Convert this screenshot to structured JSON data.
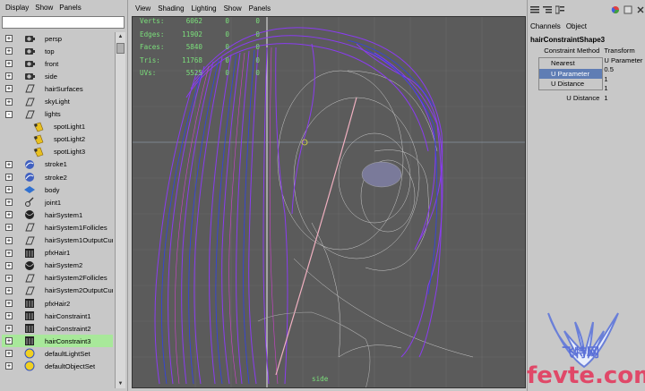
{
  "outliner": {
    "menu": [
      "Display",
      "Show",
      "Panels"
    ],
    "items": [
      {
        "label": "persp",
        "icon": "camera-icon",
        "exp": "+"
      },
      {
        "label": "top",
        "icon": "camera-icon",
        "exp": "+"
      },
      {
        "label": "front",
        "icon": "camera-icon",
        "exp": "+"
      },
      {
        "label": "side",
        "icon": "camera-icon",
        "exp": "+"
      },
      {
        "label": "hairSurfaces",
        "icon": "set-icon",
        "exp": "+"
      },
      {
        "label": "skyLight",
        "icon": "set-icon",
        "exp": "+"
      },
      {
        "label": "lights",
        "icon": "set-icon",
        "exp": "-"
      },
      {
        "label": "spotLight1",
        "icon": "spotlight-icon",
        "exp": "",
        "indent": true
      },
      {
        "label": "spotLight2",
        "icon": "spotlight-icon",
        "exp": "",
        "indent": true
      },
      {
        "label": "spotLight3",
        "icon": "spotlight-icon",
        "exp": "",
        "indent": true
      },
      {
        "label": "stroke1",
        "icon": "stroke-icon",
        "exp": "+"
      },
      {
        "label": "stroke2",
        "icon": "stroke-icon",
        "exp": "+"
      },
      {
        "label": "body",
        "icon": "mesh-icon",
        "exp": "+"
      },
      {
        "label": "joint1",
        "icon": "joint-icon",
        "exp": "+"
      },
      {
        "label": "hairSystem1",
        "icon": "hair-system-icon",
        "exp": "+"
      },
      {
        "label": "hairSystem1Follicles",
        "icon": "set-icon",
        "exp": "+"
      },
      {
        "label": "hairSystem1OutputCurves",
        "icon": "set-icon",
        "exp": "+"
      },
      {
        "label": "pfxHair1",
        "icon": "pfx-hair-icon",
        "exp": "+"
      },
      {
        "label": "hairSystem2",
        "icon": "hair-system-icon",
        "exp": "+"
      },
      {
        "label": "hairSystem2Follicles",
        "icon": "set-icon",
        "exp": "+"
      },
      {
        "label": "hairSystem2OutputCurves",
        "icon": "set-icon",
        "exp": "+"
      },
      {
        "label": "pfxHair2",
        "icon": "pfx-hair-icon",
        "exp": "+"
      },
      {
        "label": "hairConstraint1",
        "icon": "pfx-hair-icon",
        "exp": "+"
      },
      {
        "label": "hairConstraint2",
        "icon": "pfx-hair-icon",
        "exp": "+"
      },
      {
        "label": "hairConstraint3",
        "icon": "pfx-hair-icon",
        "exp": "+",
        "selected": true
      },
      {
        "label": "defaultLightSet",
        "icon": "light-set-icon",
        "exp": "+"
      },
      {
        "label": "defaultObjectSet",
        "icon": "light-set-icon",
        "exp": "+"
      }
    ]
  },
  "viewport": {
    "menu": [
      "View",
      "Shading",
      "Lighting",
      "Show",
      "Panels"
    ],
    "hud": [
      {
        "k": "Verts:",
        "v1": "6062",
        "v2": "0",
        "v3": "0"
      },
      {
        "k": "Edges:",
        "v1": "11902",
        "v2": "0",
        "v3": "0"
      },
      {
        "k": "Faces:",
        "v1": "5840",
        "v2": "0",
        "v3": "0"
      },
      {
        "k": "Tris:",
        "v1": "11768",
        "v2": "0",
        "v3": "0"
      },
      {
        "k": "UVs:",
        "v1": "5525",
        "v2": "0",
        "v3": "0"
      }
    ],
    "camera": "side"
  },
  "attributes": {
    "tabs": [
      "Channels",
      "Object"
    ],
    "node": "hairConstraintShape3",
    "rows": [
      {
        "name": "Constraint Method",
        "value": "Transform"
      },
      {
        "name": "Nearest",
        "value": "U Parameter"
      },
      {
        "name": "U Parameter",
        "value": "0.5"
      },
      {
        "name": "U Distance",
        "value": "1"
      },
      {
        "name": "U Parameter",
        "value": "1"
      },
      {
        "name": "U Distance",
        "value": "1"
      }
    ],
    "dropdown": {
      "options": [
        "Nearest",
        "U Parameter",
        "U Distance"
      ],
      "highlighted": "U Parameter"
    }
  },
  "watermark": {
    "cn": "飞特网",
    "url": "fevte.com"
  },
  "colors": {
    "panel": "#c8c8c8",
    "viewport_bg": "#5b5b5b",
    "selection": "#a8e89a",
    "hud": "#7be07b",
    "hair_purple": "#8a3cf0",
    "hair_blue": "#3040e8"
  }
}
